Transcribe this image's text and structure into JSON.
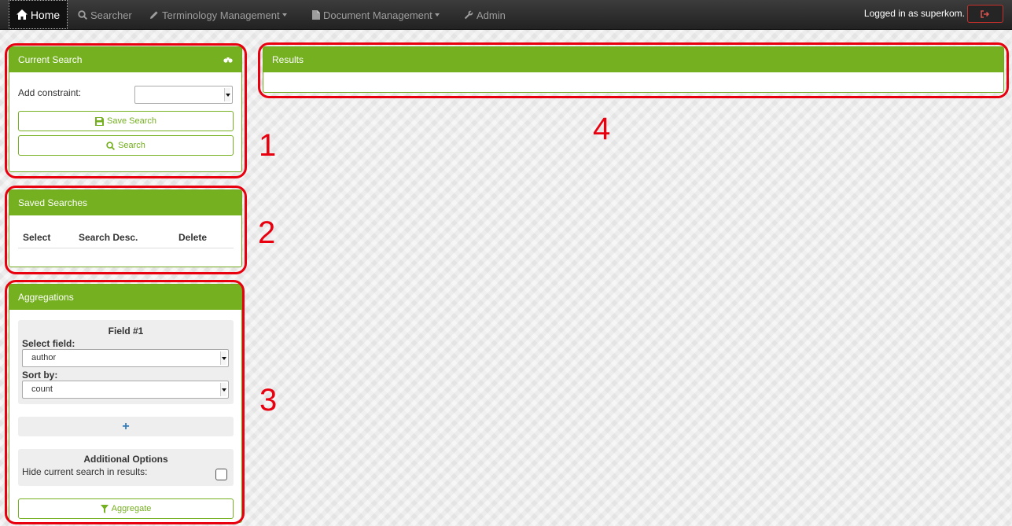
{
  "navbar": {
    "home": "Home",
    "searcher": "Searcher",
    "terminology": "Terminology Management",
    "documents": "Document Management",
    "admin": "Admin",
    "logged_in": "Logged in as superkom."
  },
  "current_search": {
    "title": "Current Search",
    "add_constraint_label": "Add constraint:",
    "add_constraint_value": "",
    "save_search_label": "Save Search",
    "search_label": "Search"
  },
  "saved_searches": {
    "title": "Saved Searches",
    "columns": [
      "Select",
      "Search Desc.",
      "Delete"
    ]
  },
  "aggregations": {
    "title": "Aggregations",
    "field_heading": "Field #1",
    "select_field_label": "Select field:",
    "select_field_value": "author",
    "sort_by_label": "Sort by:",
    "sort_by_value": "count",
    "add_field_symbol": "+",
    "additional_options_heading": "Additional Options",
    "hide_current_label": "Hide current search in results:",
    "hide_current_checked": false,
    "aggregate_label": "Aggregate"
  },
  "results": {
    "title": "Results"
  },
  "annotations": [
    "1",
    "2",
    "3",
    "4"
  ],
  "colors": {
    "accent_green": "#74b01f",
    "annotation_red": "#e8000f",
    "navbar_dark": "#222222",
    "plus_blue": "#337ab7"
  },
  "icons": {
    "home": "home-icon",
    "searcher": "search-icon",
    "terminology": "pencil-icon",
    "documents": "file-icon",
    "admin": "wrench-icon",
    "logout": "logout-icon",
    "current_search_header": "binoculars-icon",
    "save": "floppy-disk-icon",
    "search": "search-icon",
    "add": "plus-icon",
    "aggregate": "filter-icon"
  }
}
